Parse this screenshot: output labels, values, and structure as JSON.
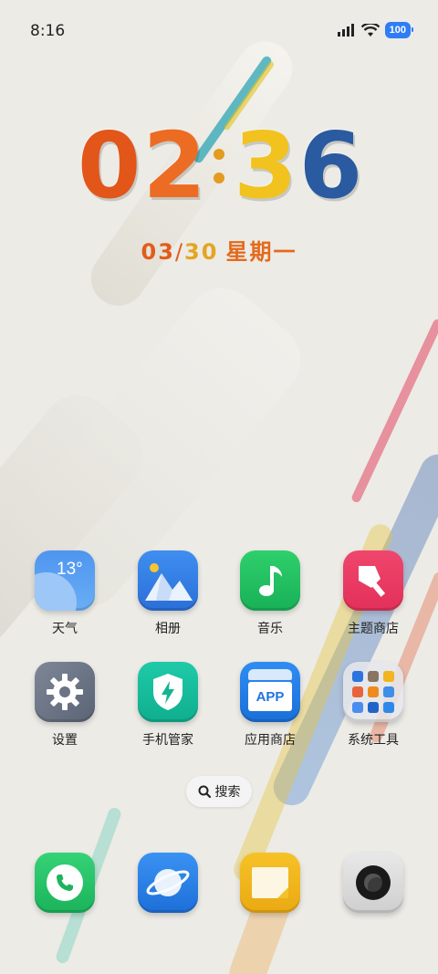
{
  "status_bar": {
    "time": "8:16",
    "battery": "100"
  },
  "clock": {
    "digits": [
      "0",
      "2",
      "3",
      "6"
    ],
    "digit_colors": [
      "#e2561a",
      "#e96a1f",
      "#f2c21e",
      "#2a5aa0"
    ]
  },
  "date": {
    "month": "03",
    "separator": "/",
    "day": "30",
    "weekday": "星期一"
  },
  "apps": [
    {
      "label": "天气",
      "icon": "weather-icon",
      "temp": "13°"
    },
    {
      "label": "相册",
      "icon": "gallery-icon"
    },
    {
      "label": "音乐",
      "icon": "music-note-icon"
    },
    {
      "label": "主题商店",
      "icon": "paintbrush-icon"
    },
    {
      "label": "设置",
      "icon": "gear-icon"
    },
    {
      "label": "手机管家",
      "icon": "shield-bolt-icon"
    },
    {
      "label": "应用商店",
      "icon": "app-store-icon",
      "badge": "APP"
    },
    {
      "label": "系统工具",
      "icon": "folder-icon"
    }
  ],
  "search": {
    "label": "搜索"
  },
  "dock": [
    {
      "icon": "phone-icon"
    },
    {
      "icon": "browser-planet-icon"
    },
    {
      "icon": "notes-icon"
    },
    {
      "icon": "camera-icon"
    }
  ]
}
